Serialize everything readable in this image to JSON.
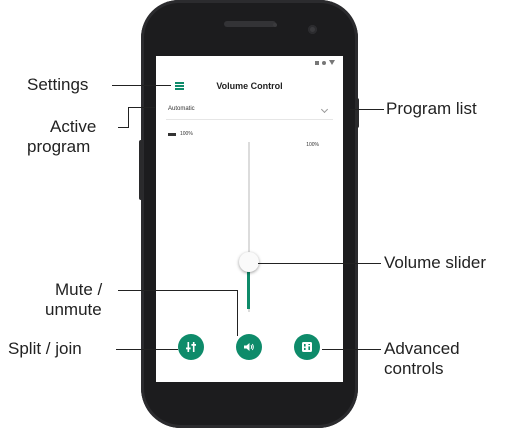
{
  "app": {
    "title": "Volume Control",
    "program": "Automatic",
    "volume_left": "100%",
    "volume_right": "100%",
    "volume_level": 0.4,
    "accent_color": "#0e8b6a"
  },
  "buttons": {
    "settings_icon": "hamburger-menu-icon",
    "split_icon": "sliders-icon",
    "mute_icon": "speaker-icon",
    "advanced_icon": "equalizer-icon"
  },
  "callouts": {
    "settings": "Settings",
    "active_program_1": "Active",
    "active_program_2": "program",
    "program_list": "Program list",
    "volume_slider": "Volume slider",
    "mute_1": "Mute /",
    "mute_2": "unmute",
    "split_join": "Split / join",
    "advanced_1": "Advanced",
    "advanced_2": "controls"
  }
}
